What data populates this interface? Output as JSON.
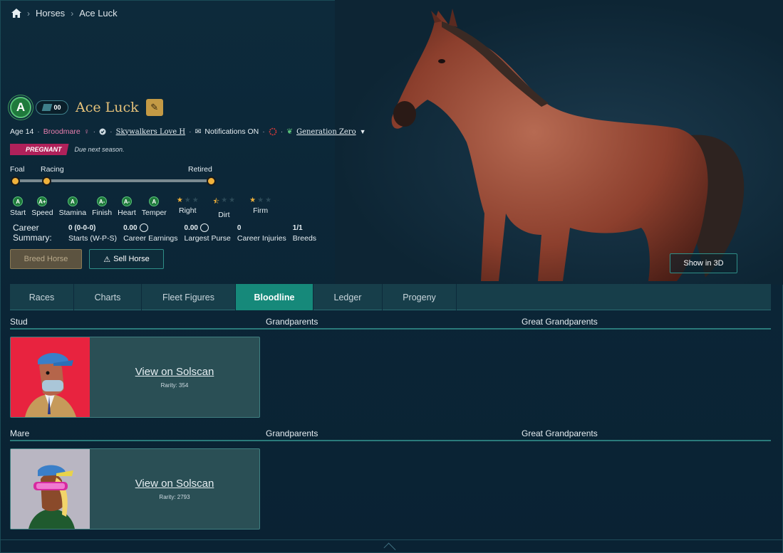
{
  "breadcrumb": {
    "items": [
      "Horses",
      "Ace Luck"
    ]
  },
  "horse": {
    "grade": "A",
    "fleet_badge": "00",
    "name": "Ace Luck",
    "age": "Age 14",
    "type": "Broodmare",
    "gender_symbol": "♀",
    "owner": "Skywalkers Love H",
    "notifications": "Notifications ON",
    "generation": "Generation Zero",
    "status_badge": "PREGNANT",
    "status_note": "Due next season."
  },
  "timeline": {
    "labels": [
      "Foal",
      "Racing",
      "Retired"
    ]
  },
  "stats": [
    {
      "grade": "A",
      "label": "Start"
    },
    {
      "grade": "A+",
      "label": "Speed"
    },
    {
      "grade": "A",
      "label": "Stamina"
    },
    {
      "grade": "A-",
      "label": "Finish"
    },
    {
      "grade": "A-",
      "label": "Heart"
    },
    {
      "grade": "A",
      "label": "Temper"
    }
  ],
  "surfaces": [
    {
      "label": "Right",
      "stars": 1
    },
    {
      "label": "Dirt",
      "stars": 0.5
    },
    {
      "label": "Firm",
      "stars": 1
    }
  ],
  "career": {
    "title": "Career Summary:",
    "starts_value": "0 (0-0-0)",
    "starts_label": "Starts (W-P-S)",
    "earnings_value": "0.00",
    "earnings_label": "Career Earnings",
    "purse_value": "0.00",
    "purse_label": "Largest Purse",
    "injuries_value": "0",
    "injuries_label": "Career Injuries",
    "breeds_value": "1/1",
    "breeds_label": "Breeds"
  },
  "buttons": {
    "breed": "Breed Horse",
    "sell": "Sell Horse",
    "show3d": "Show in 3D"
  },
  "tabs": [
    "Races",
    "Charts",
    "Fleet Figures",
    "Bloodline",
    "Ledger",
    "Progeny"
  ],
  "active_tab": "Bloodline",
  "bloodline": {
    "stud": {
      "heading": "Stud",
      "grandparents": "Grandparents",
      "great": "Great Grandparents",
      "link": "View on Solscan",
      "rarity": "Rarity: 354"
    },
    "mare": {
      "heading": "Mare",
      "grandparents": "Grandparents",
      "great": "Great Grandparents",
      "link": "View on Solscan",
      "rarity": "Rarity: 2793"
    }
  },
  "colors": {
    "accent": "#16897a",
    "gold": "#e6c27a",
    "pink": "#b0215a"
  }
}
